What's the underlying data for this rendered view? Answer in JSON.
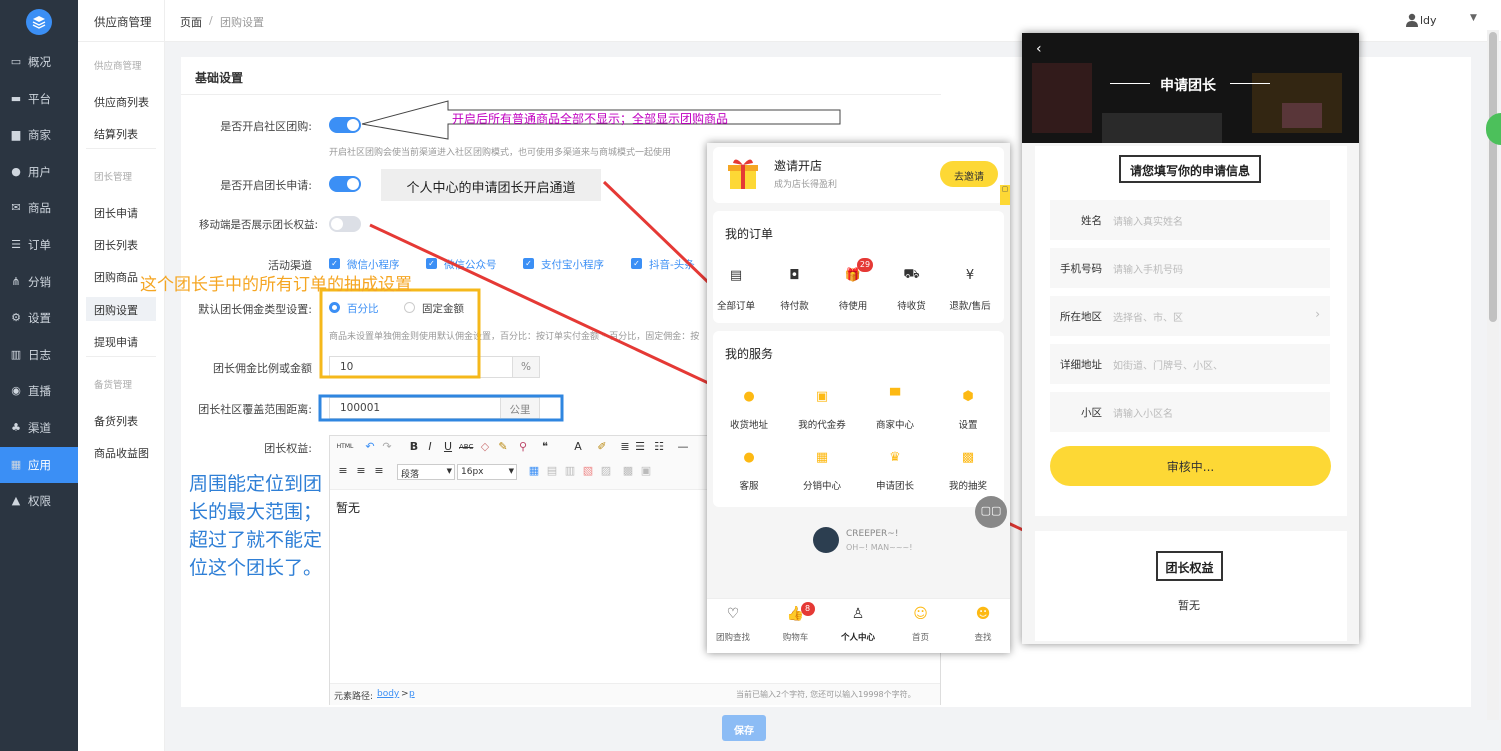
{
  "sidebar": {
    "items": [
      {
        "label": "概况",
        "icon": "chat-icon"
      },
      {
        "label": "平台",
        "icon": "monitor-icon"
      },
      {
        "label": "商家",
        "icon": "store-icon"
      },
      {
        "label": "用户",
        "icon": "user-icon"
      },
      {
        "label": "商品",
        "icon": "mail-icon"
      },
      {
        "label": "订单",
        "icon": "list-icon"
      },
      {
        "label": "分销",
        "icon": "share-icon"
      },
      {
        "label": "设置",
        "icon": "gear-icon"
      },
      {
        "label": "日志",
        "icon": "book-icon"
      },
      {
        "label": "直播",
        "icon": "live-icon"
      },
      {
        "label": "渠道",
        "icon": "channel-icon"
      },
      {
        "label": "应用",
        "icon": "grid-icon"
      },
      {
        "label": "权限",
        "icon": "lock-icon"
      }
    ],
    "active": "应用"
  },
  "subside": {
    "title": "供应商管理",
    "groups": [
      {
        "title": "供应商管理",
        "items": [
          "供应商列表",
          "结算列表"
        ]
      },
      {
        "title": "团长管理",
        "items": [
          "团长申请",
          "团长列表",
          "团购商品",
          "团购设置",
          "提现申请"
        ]
      },
      {
        "title": "备货管理",
        "items": [
          "备货列表",
          "商品收益图"
        ]
      }
    ],
    "active": "团购设置"
  },
  "topbar": {
    "breadcrumb_root": "页面",
    "breadcrumb_sep": "/",
    "breadcrumb_current": "团购设置",
    "user": "ldy"
  },
  "form": {
    "section_title": "基础设置",
    "community_label": "是否开启社区团购:",
    "community_hint": "开启社区团购会使当前渠道进入社区团购模式，也可使用多渠道来与商城模式一起使用",
    "leader_apply_label": "是否开启团长申请:",
    "show_rights_label": "移动端是否展示团长权益:",
    "channel_label": "活动渠道",
    "channels": [
      "微信小程序",
      "微信公众号",
      "支付宝小程序",
      "抖音-头条"
    ],
    "commission_type_label": "默认团长佣金类型设置:",
    "radio_percent": "百分比",
    "radio_fixed": "固定金额",
    "commission_hint": "商品未设置单独佣金则使用默认佣金设置，百分比：按订单实付金额 * 百分比，固定佣金：按",
    "commission_value_label": "团长佣金比例或金额",
    "commission_value": "10",
    "commission_unit": "%",
    "range_label": "团长社区覆盖范围距离:",
    "range_value": "100001",
    "range_unit": "公里",
    "rights_label": "团长权益:",
    "editor_content": "暂无",
    "editor_para": "段落",
    "editor_size": "16px",
    "editor_path_label": "元素路径:",
    "editor_path_body": "body",
    "editor_path_sep": ">",
    "editor_path_p": "p",
    "editor_count": "当前已输入2个字符, 您还可以输入19998个字符。",
    "save_label": "保存"
  },
  "annotations": {
    "arrow_text": "开启后所有普通商品全部不显示；全部显示团购商品",
    "box_text": "个人中心的申请团长开启通道",
    "yellow_text": "这个团长手中的所有订单的抽成设置",
    "blue_text": "周围能定位到团长的最大范围；超过了就不能定位这个团长了。"
  },
  "phone1": {
    "invite_title": "邀请开店",
    "invite_sub": "成为店长得盈利",
    "invite_btn": "去邀请",
    "orders_title": "我的订单",
    "orders": [
      {
        "label": "全部订单",
        "icon": "doc-icon"
      },
      {
        "label": "待付款",
        "icon": "wallet-icon"
      },
      {
        "label": "待使用",
        "icon": "gift-icon",
        "badge": "29"
      },
      {
        "label": "待收货",
        "icon": "truck-icon"
      },
      {
        "label": "退款/售后",
        "icon": "refund-icon"
      }
    ],
    "services_title": "我的服务",
    "services": [
      {
        "label": "收货地址",
        "icon": "location-icon"
      },
      {
        "label": "我的代金券",
        "icon": "coupon-icon"
      },
      {
        "label": "商家中心",
        "icon": "shop-icon"
      },
      {
        "label": "设置",
        "icon": "hexagon-icon"
      },
      {
        "label": "客服",
        "icon": "service-icon"
      },
      {
        "label": "分销中心",
        "icon": "distribution-icon"
      },
      {
        "label": "申请团长",
        "icon": "crown-icon"
      },
      {
        "label": "我的抽奖",
        "icon": "gift-box-icon"
      }
    ],
    "profile_name": "CREEPER~!",
    "profile_sub": "OH~! MAN~~~!",
    "nav": [
      {
        "label": "团购查找"
      },
      {
        "label": "购物车",
        "badge": "8"
      },
      {
        "label": "个人中心"
      },
      {
        "label": "首页"
      },
      {
        "label": "查找"
      }
    ],
    "nav_active": "个人中心"
  },
  "phone2": {
    "title": "申请团长",
    "form_title": "请您填写你的申请信息",
    "fields": [
      {
        "label": "姓名",
        "placeholder": "请输入真实姓名"
      },
      {
        "label": "手机号码",
        "placeholder": "请输入手机号码"
      },
      {
        "label": "所在地区",
        "placeholder": "选择省、市、区"
      },
      {
        "label": "详细地址",
        "placeholder": "如街道、门牌号、小区、"
      },
      {
        "label": "小区",
        "placeholder": "请输入小区名"
      }
    ],
    "status_btn": "审核中...",
    "rights_title": "团长权益",
    "rights_content": "暂无"
  },
  "colors": {
    "primary": "#3b8ff5",
    "sidebar": "#2b3541",
    "yellow": "#fdd835",
    "arrow": "#e53935",
    "annot_yellow": "#f5a623",
    "annot_blue": "#2f7fd6"
  }
}
